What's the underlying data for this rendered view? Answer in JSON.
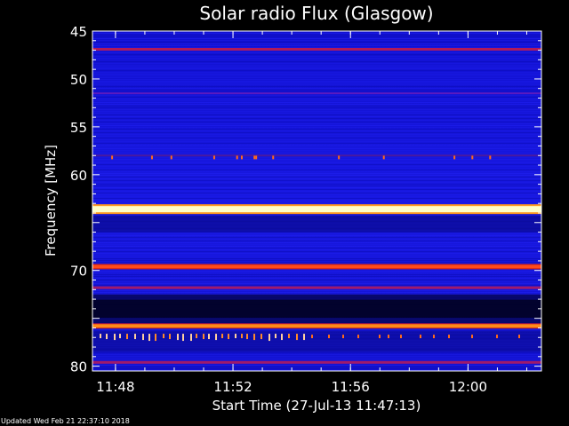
{
  "chart_data": {
    "type": "heatmap",
    "title": "Solar radio Flux (Glasgow)",
    "xlabel": "Start Time (27-Jul-13 11:47:13)",
    "ylabel": "Frequency [MHz]",
    "x_range": [
      "11:47:13",
      "12:02:30"
    ],
    "x_ticks": [
      "11:48",
      "11:52",
      "11:56",
      "12:00"
    ],
    "y_range_mhz": [
      45,
      80.5
    ],
    "y_ticks": [
      45,
      50,
      55,
      60,
      65,
      70,
      75,
      80
    ],
    "y_tick_labels": [
      "45",
      "50",
      "55",
      "60",
      "",
      "70",
      "",
      "80"
    ],
    "y_axis_inverted": true,
    "background_color": "#1515d8",
    "colormap": [
      "#000040",
      "#0a0aa0",
      "#1a1ae0",
      "#c01818",
      "#ff7010",
      "#ffffb0"
    ],
    "bands": [
      {
        "freq_mhz": 46.9,
        "intensity": "medium",
        "color": "#b01a5a"
      },
      {
        "freq_mhz": 51.5,
        "intensity": "low",
        "color": "#5a1ac0"
      },
      {
        "freq_mhz": 58.0,
        "intensity": "low",
        "color": "#4a1aa0"
      },
      {
        "freq_mhz": 63.6,
        "intensity": "very high",
        "color": "#ffffc8"
      },
      {
        "freq_mhz": 69.6,
        "intensity": "high",
        "color": "#ff4a1a"
      },
      {
        "freq_mhz": 71.8,
        "intensity": "medium",
        "color": "#a01a6a"
      },
      {
        "freq_mhz": 75.8,
        "intensity": "high",
        "color": "#ff8a1a"
      },
      {
        "freq_mhz": 79.6,
        "intensity": "medium",
        "color": "#a01a6a"
      }
    ],
    "dark_region_mhz": [
      72.5,
      75.5
    ]
  },
  "footer": "Updated Wed Feb 21 22:37:10 2018"
}
